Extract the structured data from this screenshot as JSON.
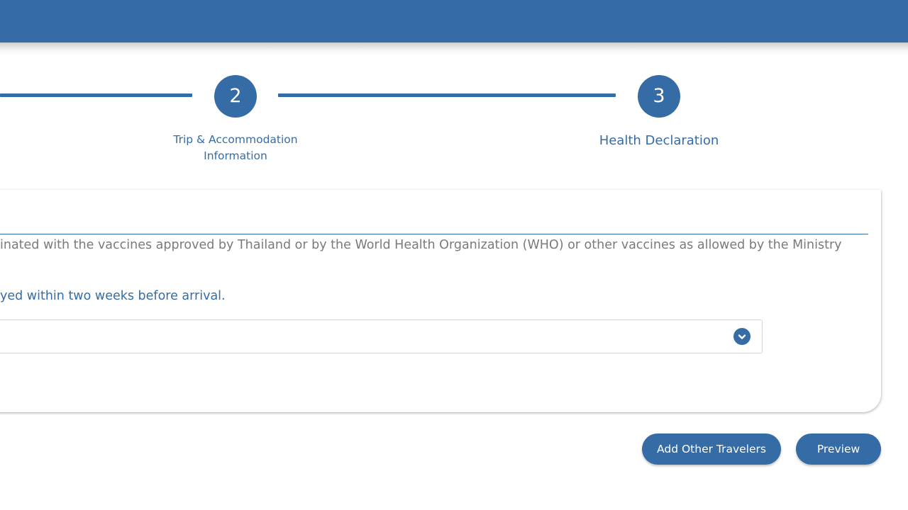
{
  "stepper": {
    "steps": [
      {
        "number": "2",
        "label_line1": "Trip & Accommodation",
        "label_line2": "Information"
      },
      {
        "number": "3",
        "label_line1": "Health Declaration"
      }
    ]
  },
  "form": {
    "question_text": "inated with the vaccines approved by Thailand or by the World Health Organization (WHO) or other vaccines as allowed by the Ministry",
    "sub_question_text": "yed within two weeks before arrival.",
    "select_value": ""
  },
  "actions": {
    "add_travelers_label": "Add Other Travelers",
    "preview_label": "Preview"
  },
  "colors": {
    "primary": "#366ca6",
    "muted_text": "#7a7a7a"
  },
  "icons": {
    "select_toggle": "chevron-down-icon"
  }
}
